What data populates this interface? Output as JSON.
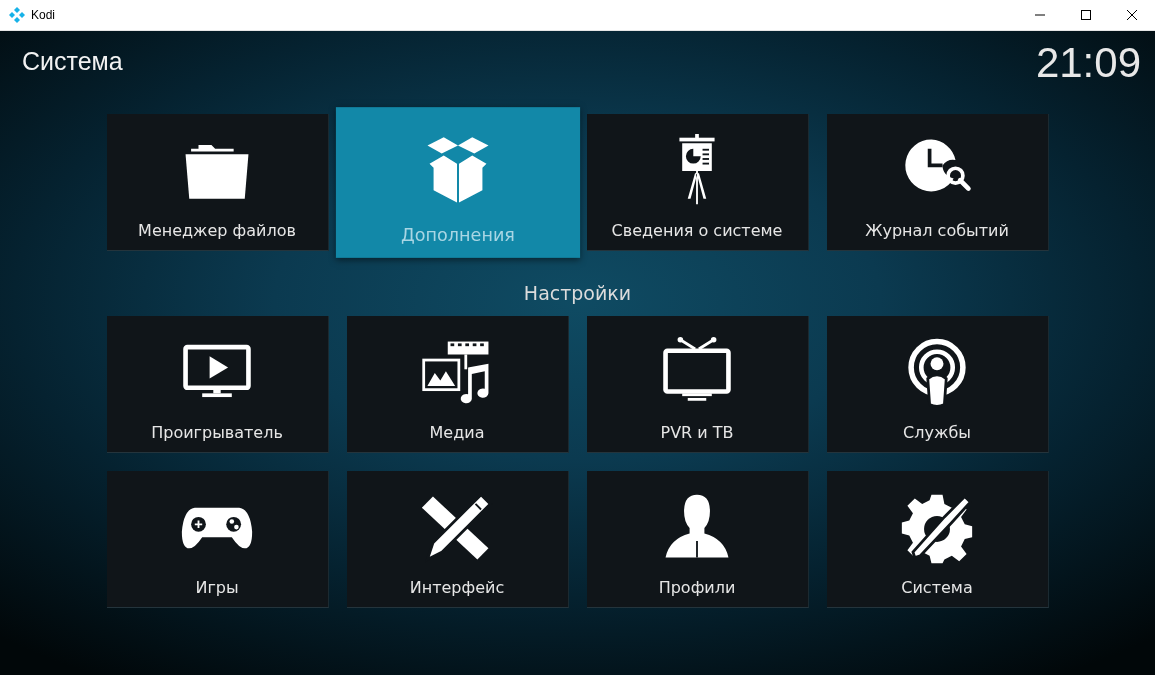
{
  "window": {
    "title": "Kodi"
  },
  "header": {
    "title": "Система",
    "clock": "21:09"
  },
  "top_tiles": [
    {
      "label": "Менеджер файлов",
      "selected": false
    },
    {
      "label": "Дополнения",
      "selected": true
    },
    {
      "label": "Сведения о системе",
      "selected": false
    },
    {
      "label": "Журнал событий",
      "selected": false
    }
  ],
  "section": {
    "title": "Настройки"
  },
  "settings_tiles": [
    {
      "label": "Проигрыватель",
      "selected": false
    },
    {
      "label": "Медиа",
      "selected": false
    },
    {
      "label": "PVR и ТВ",
      "selected": false
    },
    {
      "label": "Службы",
      "selected": false
    },
    {
      "label": "Игры",
      "selected": false
    },
    {
      "label": "Интерфейс",
      "selected": false
    },
    {
      "label": "Профили",
      "selected": false
    },
    {
      "label": "Система",
      "selected": false
    }
  ]
}
